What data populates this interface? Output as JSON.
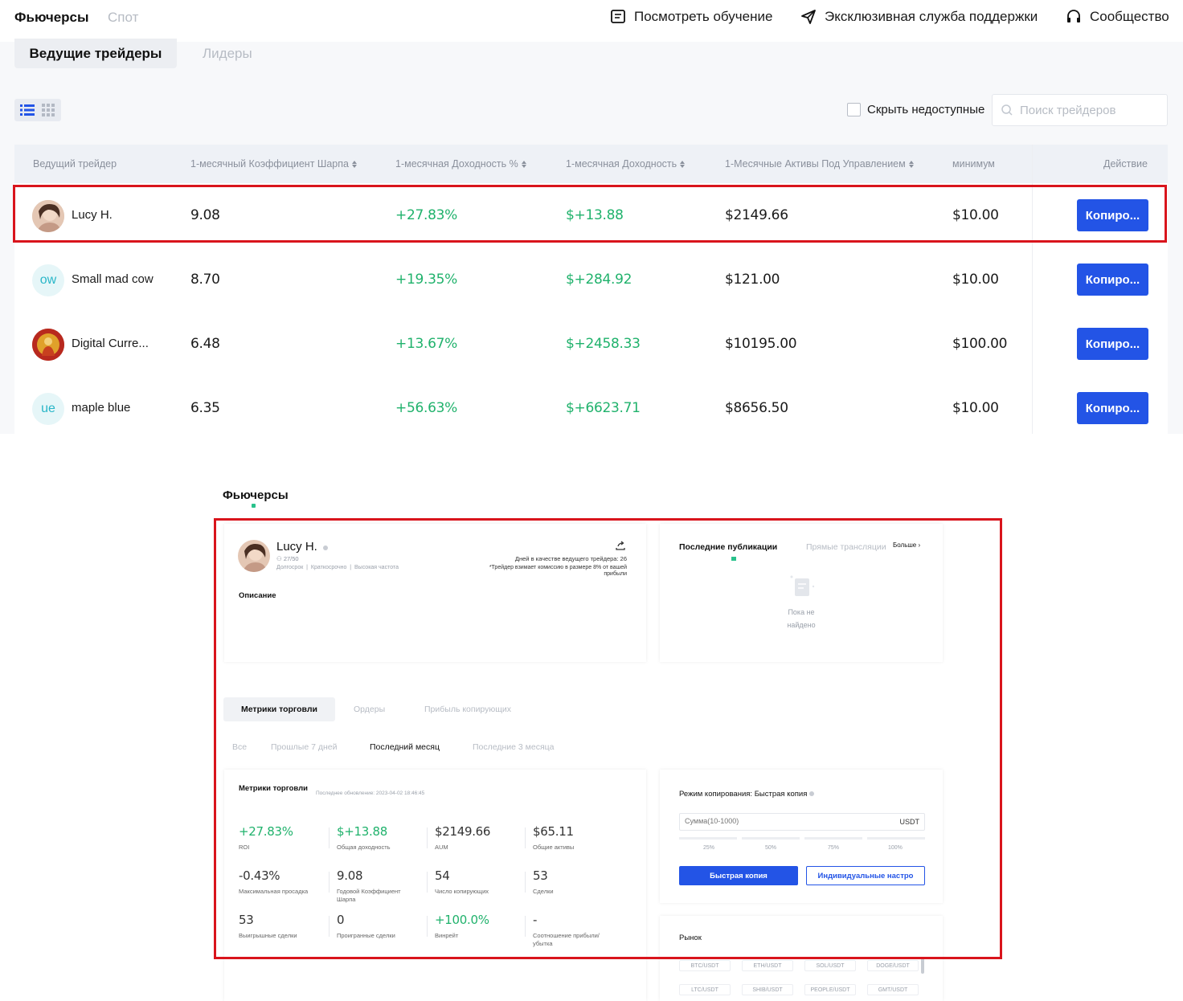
{
  "top": {
    "tabs": [
      "Фьючерсы",
      "Спот"
    ],
    "links": {
      "tutorial": "Посмотреть обучение",
      "support": "Эксклюзивная служба поддержки",
      "community": "Сообщество"
    },
    "subtabs": [
      "Ведущие трейдеры",
      "Лидеры"
    ],
    "hide_unavailable": "Скрыть недоступные",
    "search_placeholder": "Поиск трейдеров",
    "columns": [
      "Ведущий трейдер",
      "1-месячный Коэффициент Шарпа",
      "1-месячная Доходность %",
      "1-месячная Доходность",
      "1-Месячные Активы Под Управлением",
      "минимум",
      "Действие"
    ],
    "rows": [
      {
        "avatar_text": "",
        "name": "Lucy H.",
        "sharpe": "9.08",
        "roi": "+27.83%",
        "pnl": "$+13.88",
        "aum": "$2149.66",
        "min": "$10.00",
        "action": "Копиро..."
      },
      {
        "avatar_text": "ow",
        "name": "Small mad cow",
        "sharpe": "8.70",
        "roi": "+19.35%",
        "pnl": "$+284.92",
        "aum": "$121.00",
        "min": "$10.00",
        "action": "Копиро..."
      },
      {
        "avatar_text": "",
        "name": "Digital Curre...",
        "sharpe": "6.48",
        "roi": "+13.67%",
        "pnl": "$+2458.33",
        "aum": "$10195.00",
        "min": "$100.00",
        "action": "Копиро..."
      },
      {
        "avatar_text": "ue",
        "name": "maple blue",
        "sharpe": "6.35",
        "roi": "+56.63%",
        "pnl": "$+6623.71",
        "aum": "$8656.50",
        "min": "$10.00",
        "action": "Копиро..."
      }
    ]
  },
  "detail": {
    "section_title": "Фьючерсы",
    "profile": {
      "name": "Lucy H.",
      "followers": "27/50",
      "tags": [
        "Долгосрок",
        "Краткосрочно",
        "Высокая частота"
      ],
      "days_text": "Дней в качестве ведущего трейдера: 26",
      "commission_text": "*Трейдер взимает комиссию в размере 8% от вашей прибыли",
      "description_label": "Описание"
    },
    "posts": {
      "tab_latest": "Последние публикации",
      "tab_live": "Прямые трансляции",
      "more": "Больше",
      "empty": "Пока не найдено"
    },
    "tabs": [
      "Метрики торговли",
      "Ордеры",
      "Прибыль копирующих"
    ],
    "periods": [
      "Все",
      "Прошлые 7 дней",
      "Последний месяц",
      "Последние 3 месяца"
    ],
    "metrics_title": "Метрики торговли",
    "metrics_updated": "Последнее обновление: 2023-04-02 18:46:45",
    "metrics": [
      {
        "value": "+27.83%",
        "label": "ROI",
        "green": true
      },
      {
        "value": "$+13.88",
        "label": "Общая доходность",
        "green": true
      },
      {
        "value": "$2149.66",
        "label": "AUM",
        "green": false
      },
      {
        "value": "$65.11",
        "label": "Общие активы",
        "green": false
      },
      {
        "value": "-0.43%",
        "label": "Максимальная просадка",
        "green": false
      },
      {
        "value": "9.08",
        "label": "Годовой Коэффициент Шарпа",
        "green": false
      },
      {
        "value": "54",
        "label": "Число копирующих",
        "green": false
      },
      {
        "value": "53",
        "label": "Сделки",
        "green": false
      },
      {
        "value": "53",
        "label": "Выигрышные сделки",
        "green": false
      },
      {
        "value": "0",
        "label": "Проигранные сделки",
        "green": false
      },
      {
        "value": "+100.0%",
        "label": "Винрейт",
        "green": true
      },
      {
        "value": "-",
        "label": "Соотношение прибыли/убытка",
        "green": false
      }
    ],
    "copy": {
      "mode": "Режим копирования: Быстрая копия",
      "amount_placeholder": "Сумма(10-1000)",
      "unit": "USDT",
      "percents": [
        "25%",
        "50%",
        "75%",
        "100%"
      ],
      "quick_copy": "Быстрая копия",
      "custom": "Индивидуальные настро"
    },
    "market": {
      "title": "Рынок",
      "pairs": [
        "BTC/USDT",
        "ETH/USDT",
        "SOL/USDT",
        "DOGE/USDT",
        "LTC/USDT",
        "SHIB/USDT",
        "PEOPLE/USDT",
        "GMT/USDT"
      ]
    }
  },
  "colors": {
    "green": "#20b26c",
    "blue": "#2354e6",
    "red_box": "#d9141c",
    "accent": "#29c28c"
  }
}
